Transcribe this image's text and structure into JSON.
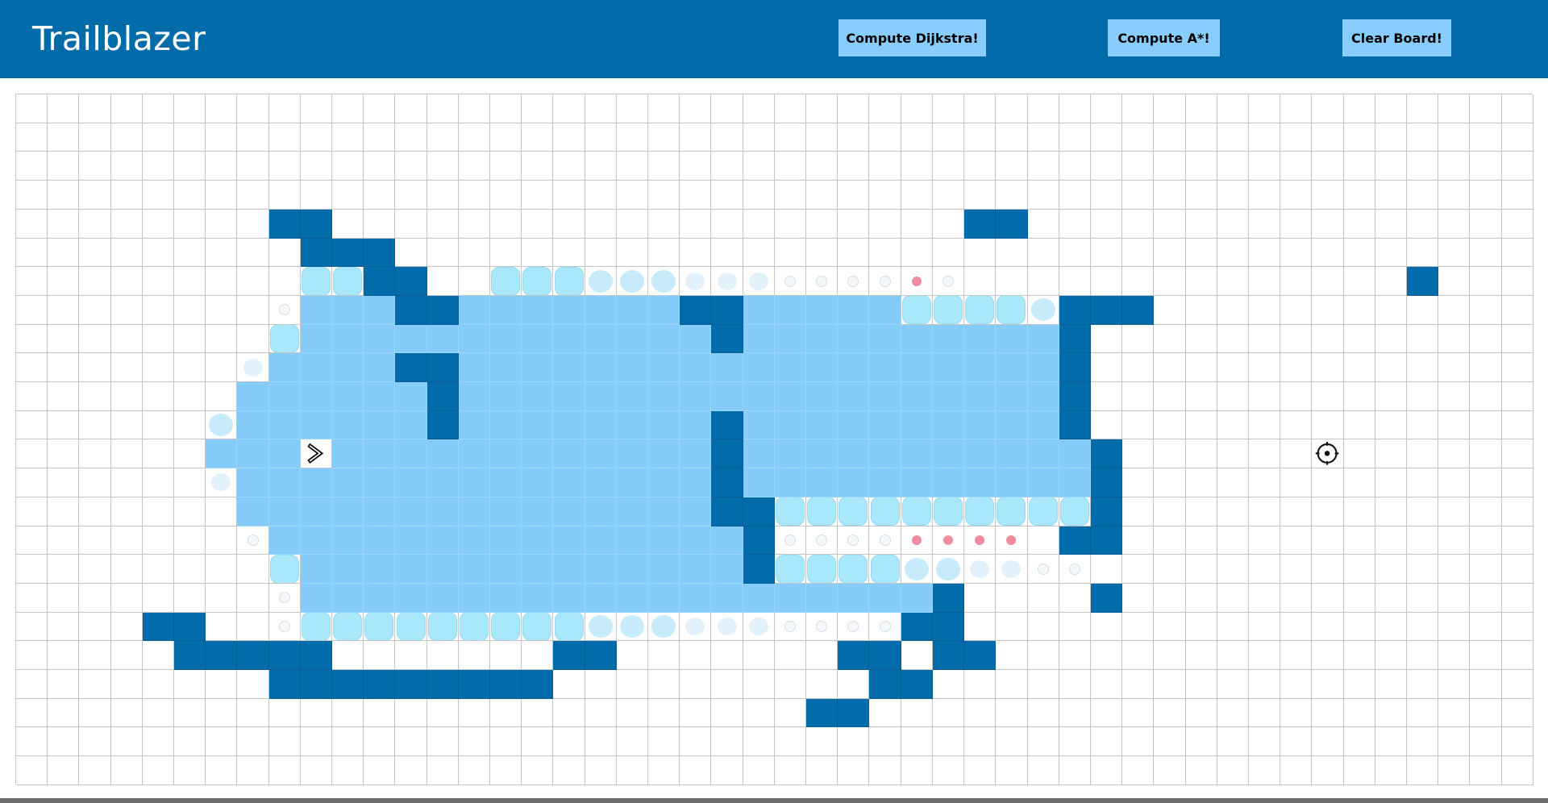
{
  "header": {
    "title": "Trailblazer",
    "buttons": {
      "dijkstra": "Compute Dijkstra!",
      "astar": "Compute A*!",
      "clear": "Clear Board!"
    }
  },
  "colors": {
    "header_bg": "#026ba9",
    "button_bg": "#89cdff",
    "wall": "#026ba9",
    "visited": "#86ccfb",
    "frontier_bubble": "#a9e8fb",
    "frontier_faint": "#e3f1fb",
    "frontier_pink": "#f08ca0",
    "grid_line": "#c4c4c4"
  },
  "grid": {
    "rows": 24,
    "cols": 48,
    "start_icon": "chevron-right-icon",
    "target_icon": "crosshair-target-icon",
    "map": [
      "................................................",
      "................................................",
      "................................................",
      "................................................",
      "........WW....................WW................",
      ".........WWW....................................",
      ".........FFWW..FFFFFFFFFFFFFFF..............W...",
      "........FVVVWWVVVVVVVWWVVVVVFFFFFWWW...........",
      "........FVVVVVVVVVVVVVWVVVVVVVVVVW..............",
      ".......FVVVVWWVVVVVVVVVVVVVVVVVVVW..............",
      ".......VVVVVVWVVVVVVVVVVVVVVVVVVVW..............",
      "......FVVVVVVWVVVVVVVVWVVVVVVVVVVW..............",
      "......VVVSVVVVVVVVVVVVWVVVVVVVVVVVW......T......",
      "......FVVVVVVVVVVVVVVVWVVVVVVVVVVVW.............",
      ".......VVVVVVVVVVVVVVVWWFFFFFFFFFFW.............",
      ".......FVVVVVVVVVVVVVVVWFFFFFFFF.WW.............",
      "........FVVVVVVVVVVVVVVWFFFFFFFFFF...............",
      "........FVVVVVVVVVVVVVVVVVVVVW....W.............",
      "....WW..FFFFFFFFFFFFFFFFFFFFWW..................",
      ".....WWWWW.......WW.......WW.WW..................",
      "........WWWWWWWWW..........WW...................",
      ".........................WW.....................",
      "................................................",
      "................................................"
    ],
    "frontier_styles": {
      "6,9": "big",
      "6,10": "big",
      "6,14": "big",
      "6,15": "big",
      "6,16": "big",
      "6,17": "big",
      "6,18": "mid",
      "6,19": "mid",
      "6,20": "mid",
      "6,21": "faint",
      "6,22": "faint",
      "6,23": "faint",
      "6,24": "small",
      "6,25": "small",
      "6,26": "small",
      "6,27": "small",
      "6,28": "pink",
      "7,8": "small",
      "7,28": "big",
      "7,29": "big",
      "7,30": "big",
      "7,31": "big",
      "7,32": "mid",
      "8,8": "big",
      "9,7": "faint",
      "11,6": "mid",
      "13,6": "faint",
      "14,24": "big",
      "14,25": "big",
      "14,26": "big",
      "14,27": "big",
      "14,28": "big",
      "14,29": "big",
      "14,30": "big",
      "14,31": "big",
      "14,32": "big",
      "14,33": "big",
      "15,24": "small",
      "15,25": "small",
      "15,26": "small",
      "15,27": "small",
      "15,28": "pink",
      "15,29": "pink",
      "15,30": "pink",
      "15,31": "pink",
      "16,8": "big",
      "16,24": "big",
      "16,25": "big",
      "16,26": "big",
      "16,27": "big",
      "16,28": "mid",
      "16,29": "mid",
      "16,30": "faint",
      "16,31": "faint",
      "16,32": "small",
      "16,33": "small",
      "17,8": "small",
      "18,8": "small",
      "18,9": "big",
      "18,10": "big",
      "18,11": "big",
      "18,12": "big",
      "18,13": "big",
      "18,14": "big",
      "18,15": "big",
      "18,16": "big",
      "18,17": "big",
      "18,18": "mid",
      "18,19": "mid",
      "18,20": "mid",
      "18,21": "faint",
      "18,22": "faint",
      "18,23": "faint",
      "18,24": "small",
      "18,25": "small",
      "18,26": "small",
      "18,27": "small"
    }
  }
}
